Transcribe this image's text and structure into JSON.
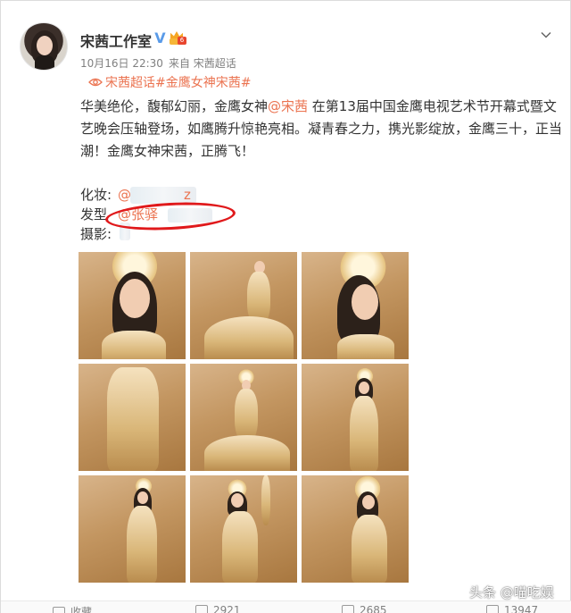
{
  "user": {
    "name": "宋茜工作室"
  },
  "meta": {
    "time": "10月16日 22:30",
    "source": "来自 宋茜超话"
  },
  "topic": {
    "text": "宋茜超话#金鹰女神宋茜#"
  },
  "post": {
    "text_before": "华美绝伦，馥郁幻丽，金鹰女神",
    "mention": "@宋茜",
    "text_after": " 在第13届中国金鹰电视艺术节开幕式暨文艺晚会压轴登场，如鹰腾升惊艳亮相。凝青春之力，携光影绽放，金鹰三十，正当潮！金鹰女神宋茜，正腾飞！"
  },
  "credits": [
    {
      "label": "化妆:",
      "mention": "@",
      "tail": "z"
    },
    {
      "label": "发型",
      "mention": "@张驿"
    },
    {
      "label": "摄影:"
    }
  ],
  "actions": [
    {
      "label": "收藏"
    },
    {
      "label": "2921"
    },
    {
      "label": "2685"
    },
    {
      "label": "13947"
    }
  ],
  "watermark": "头条 @喵吃娱",
  "colors": {
    "accent": "#eb7350",
    "annotation": "#e0191b",
    "verified": "#5a9be8"
  }
}
